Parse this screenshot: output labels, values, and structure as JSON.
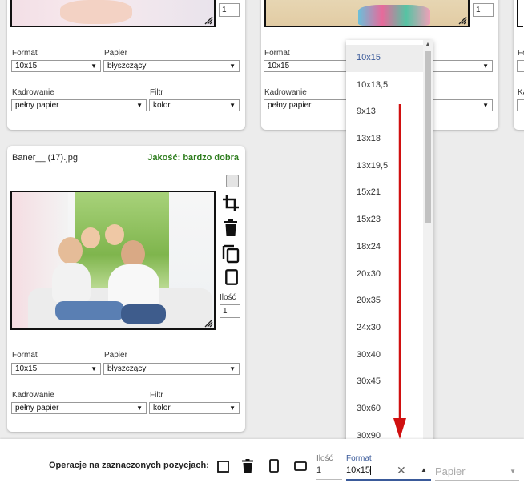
{
  "cards": {
    "top_left": {
      "quantity": "1",
      "format_label": "Format",
      "format_value": "10x15",
      "paper_label": "Papier",
      "paper_value": "błyszczący",
      "crop_label": "Kadrowanie",
      "crop_value": "pełny papier",
      "filter_label": "Filtr",
      "filter_value": "kolor"
    },
    "top_middle": {
      "quantity": "1",
      "format_label": "Format",
      "format_value": "10x15",
      "crop_label": "Kadrowanie",
      "crop_value": "pełny papier"
    },
    "top_right": {
      "format_label_partial": "Fo",
      "crop_label_partial": "Ka"
    },
    "main": {
      "filename": "Baner__ (17).jpg",
      "quality": "Jakość: bardzo dobra",
      "quantity_label": "Ilość",
      "quantity": "1",
      "format_label": "Format",
      "format_value": "10x15",
      "paper_label": "Papier",
      "paper_value": "błyszczący",
      "crop_label": "Kadrowanie",
      "crop_value": "pełny papier",
      "filter_label": "Filtr",
      "filter_value": "kolor"
    }
  },
  "format_dropdown": {
    "selected": "10x15",
    "options": [
      "10x15",
      "10x13,5",
      "9x13",
      "13x18",
      "13x19,5",
      "15x21",
      "15x23",
      "18x24",
      "20x30",
      "20x35",
      "24x30",
      "30x40",
      "30x45",
      "30x60",
      "30x90"
    ]
  },
  "bottom_bar": {
    "operations_label": "Operacje na zaznaczonych pozycjach:",
    "quantity_label": "Ilość",
    "quantity_value": "1",
    "format_label": "Format",
    "format_value": "10x15",
    "paper_placeholder": "Papier"
  },
  "colors": {
    "quality_green": "#2e7d1e",
    "link_blue": "#3a5a9a",
    "arrow_red": "#d01010"
  }
}
